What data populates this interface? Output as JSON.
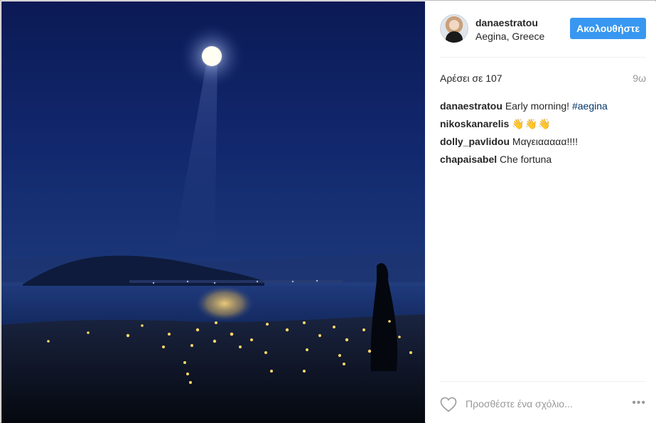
{
  "photo": {
    "alt": "Full moon over the sea at night with town lights"
  },
  "header": {
    "username": "danaestratou",
    "location": "Aegina, Greece",
    "follow_label": "Ακολουθήστε"
  },
  "meta": {
    "likes": "Αρέσει σε 107",
    "time": "9ω"
  },
  "comments": [
    {
      "author": "danaestratou",
      "text": "Early morning!",
      "hashtag": "#aegina"
    },
    {
      "author": "nikoskanarelis",
      "text": "👋👋👋"
    },
    {
      "author": "dolly_pavlidou",
      "text": "Μαγειααααα!!!!"
    },
    {
      "author": "chapaisabel",
      "text": "Che fortuna"
    }
  ],
  "comment_box": {
    "placeholder": "Προσθέστε ένα σχόλιο..."
  },
  "icons": {
    "like": "heart-icon",
    "options": "more-options-icon"
  },
  "colors": {
    "accent": "#3897f0",
    "hashtag": "#003569",
    "muted": "#999999",
    "text": "#262626"
  }
}
